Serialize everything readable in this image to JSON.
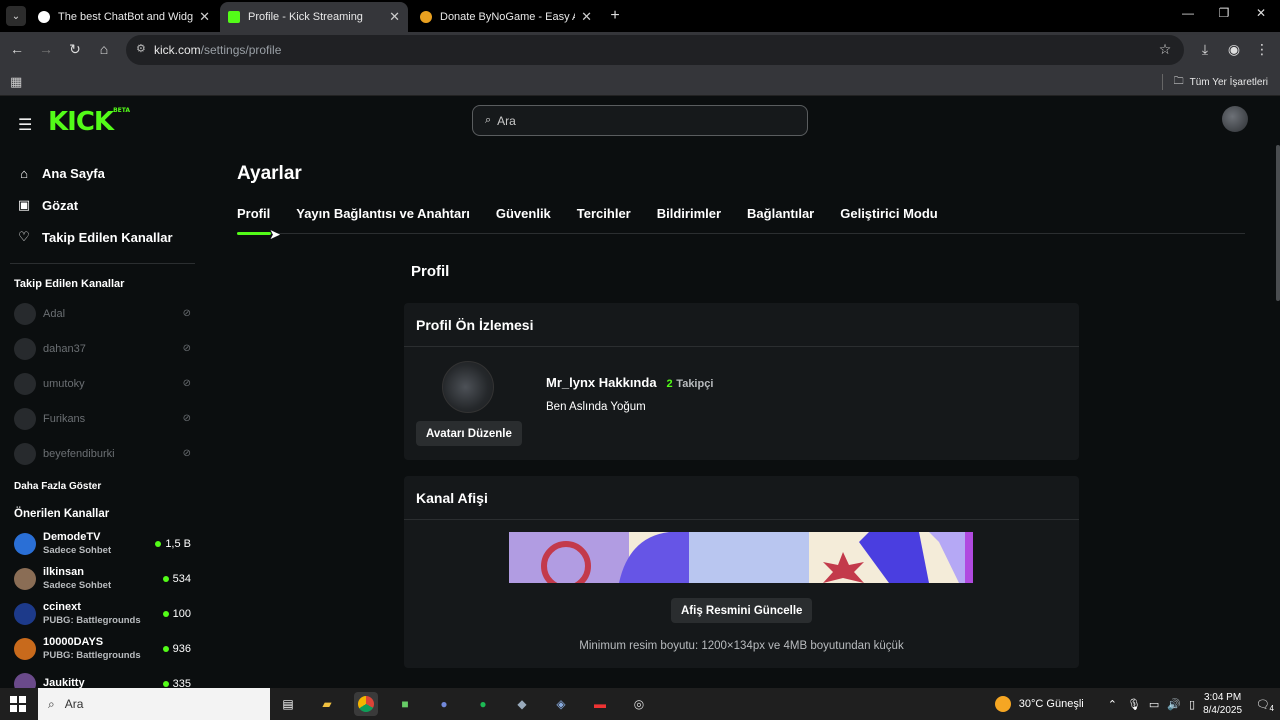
{
  "browser": {
    "tabs": [
      {
        "title": "The best ChatBot and Widgets",
        "close": "✕"
      },
      {
        "title": "Profile - Kick Streaming",
        "close": "✕"
      },
      {
        "title": "Donate ByNoGame - Easy Appl",
        "close": "✕"
      }
    ],
    "new_tab": "+",
    "url_host": "kick.com",
    "url_path": "/settings/profile",
    "bookmarks_all": "Tüm Yer İşaretleri",
    "window_controls": [
      "minimize",
      "maximize",
      "close"
    ]
  },
  "header": {
    "logo": "KICK",
    "logo_badge": "BETA",
    "search_placeholder": "Ara"
  },
  "sidebar": {
    "nav": [
      {
        "label": "Ana Sayfa",
        "icon": "home-icon"
      },
      {
        "label": "Gözat",
        "icon": "browse-icon"
      },
      {
        "label": "Takip Edilen Kanallar",
        "icon": "heart-icon"
      }
    ],
    "followed_title": "Takip Edilen Kanallar",
    "followed": [
      "Adal",
      "dahan37",
      "umutoky",
      "Furikans",
      "beyefendiburki"
    ],
    "show_more": "Daha Fazla Göster",
    "recommended_title": "Önerilen Kanallar",
    "recommended": [
      {
        "name": "DemodeTV",
        "category": "Sadece Sohbet",
        "viewers": "1,5 B",
        "color": "#2a6fd6"
      },
      {
        "name": "ilkinsan",
        "category": "Sadece Sohbet",
        "viewers": "534",
        "color": "#8a6d55"
      },
      {
        "name": "ccinext",
        "category": "PUBG: Battlegrounds",
        "viewers": "100",
        "color": "#1d3a8a"
      },
      {
        "name": "10000DAYS",
        "category": "PUBG: Battlegrounds",
        "viewers": "936",
        "color": "#c86a1c"
      },
      {
        "name": "Jaukitty",
        "category": "",
        "viewers": "335",
        "color": "#6a4a8a"
      }
    ]
  },
  "settings": {
    "title": "Ayarlar",
    "tabs": [
      "Profil",
      "Yayın Bağlantısı ve Anahtarı",
      "Güvenlik",
      "Tercihler",
      "Bildirimler",
      "Bağlantılar",
      "Geliştirici Modu"
    ],
    "active_tab": "Profil",
    "section_title": "Profil",
    "preview": {
      "title": "Profil Ön İzlemesi",
      "username_about": "Mr_lynx Hakkında",
      "followers_count": "2",
      "followers_label": "Takipçi",
      "bio": "Ben Aslında Yoğum",
      "edit_avatar": "Avatarı Düzenle"
    },
    "banner": {
      "title": "Kanal Afişi",
      "update_button": "Afiş Resmini Güncelle",
      "note": "Minimum resim boyutu: 1200×134px ve 4MB boyutundan küçük"
    }
  },
  "taskbar": {
    "search_placeholder": "Ara",
    "weather": "30°C  Güneşli",
    "time": "3:04 PM",
    "date": "8/4/2025",
    "notification_count": "4"
  },
  "colors": {
    "accent": "#53fc18",
    "background": "#0b0e0f",
    "card": "#15181a"
  }
}
